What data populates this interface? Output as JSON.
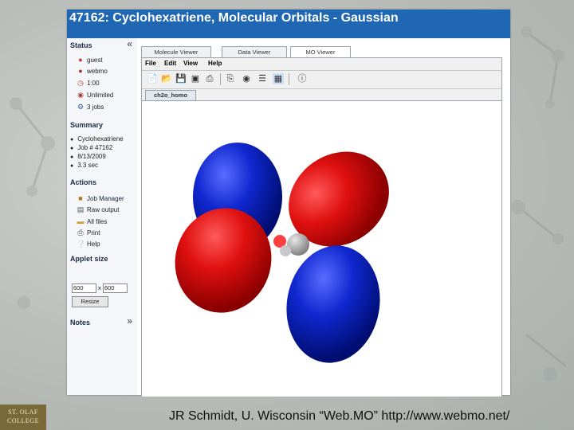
{
  "window": {
    "title": "47162: Cyclohexatriene, Molecular Orbitals - Gaussian"
  },
  "sidebar": {
    "collapse_glyph": "«",
    "status_heading": "Status",
    "status_items": [
      {
        "icon": "user-icon",
        "label": "guest"
      },
      {
        "icon": "group-icon",
        "label": "webmo"
      },
      {
        "icon": "clock-icon",
        "label": "1:00"
      },
      {
        "icon": "disk-icon",
        "label": "Unlimited"
      },
      {
        "icon": "gear-icon",
        "label": "3 jobs"
      }
    ],
    "summary_heading": "Summary",
    "summary_items": [
      "Cyclohexatriene",
      "Job # 47162",
      "8/13/2009",
      "3.3 sec"
    ],
    "actions_heading": "Actions",
    "action_items": [
      {
        "icon": "job-manager-icon",
        "label": "Job Manager"
      },
      {
        "icon": "document-icon",
        "label": "Raw output"
      },
      {
        "icon": "folder-icon",
        "label": "All files"
      },
      {
        "icon": "printer-icon",
        "label": "Print"
      },
      {
        "icon": "help-icon",
        "label": "Help"
      }
    ],
    "applet_size_heading": "Applet size",
    "applet_width": "600",
    "applet_size_sep": "x",
    "applet_height": "600",
    "resize_label": "Resize",
    "notes_heading": "Notes",
    "notes_expand_glyph": "»"
  },
  "viewer": {
    "tabs": [
      "Molecule Viewer",
      "Data Viewer",
      "MO Viewer"
    ],
    "active_tab": "MO Viewer",
    "menu": [
      "File",
      "Edit",
      "View",
      "Help"
    ],
    "document_tab": "ch2o_homo",
    "orbital_colors": {
      "positive": "#e01010",
      "negative": "#1028d0"
    }
  },
  "slide": {
    "caption": "JR Schmidt, U. Wisconsin “Web.MO”   http://www.webmo.net/",
    "logo_line1": "ST. OLAF",
    "logo_line2": "COLLEGE"
  }
}
